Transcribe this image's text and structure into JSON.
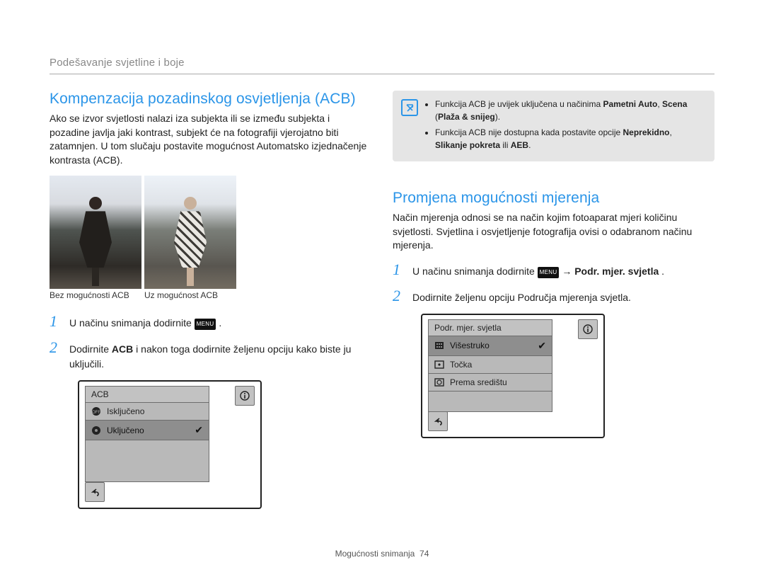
{
  "breadcrumb": "Podešavanje svjetline i boje",
  "left": {
    "heading": "Kompenzacija pozadinskog osvjetljenja (ACB)",
    "intro": "Ako se izvor svjetlosti nalazi iza subjekta ili se između subjekta i pozadine javlja jaki kontrast, subjekt će na fotografiji vjerojatno biti zatamnjen. U tom slučaju postavite mogućnost Automatsko izjednačenje kontrasta (ACB).",
    "caption_left": "Bez mogućnosti ACB",
    "caption_right": "Uz mogućnost ACB",
    "step1_pre": "U načinu snimanja dodirnite ",
    "step1_menu": "MENU",
    "step1_post": " .",
    "step2_a": "Dodirnite ",
    "step2_b": "ACB",
    "step2_c": " i nakon toga dodirnite željenu opciju kako biste ju uključili.",
    "panel": {
      "title": "ACB",
      "row1": "Isključeno",
      "row2": "Uključeno"
    }
  },
  "right": {
    "note_line1_a": "Funkcija ACB je uvijek uključena u načinima ",
    "note_line1_b": "Pametni Auto",
    "note_line1_c": ", ",
    "note_line1_d": "Scena",
    "note_line1_e": " (",
    "note_line1_f": "Plaža & snijeg",
    "note_line1_g": ").",
    "note_line2_a": "Funkcija ACB nije dostupna kada postavite opcije ",
    "note_line2_b": "Neprekidno",
    "note_line2_c": ", ",
    "note_line2_d": "Slikanje pokreta",
    "note_line2_e": " ili ",
    "note_line2_f": "AEB",
    "note_line2_g": ".",
    "heading": "Promjena mogućnosti mjerenja",
    "intro": "Način mjerenja odnosi se na način kojim fotoaparat mjeri količinu svjetlosti. Svjetlina i osvjetljenje fotografija ovisi o odabranom načinu mjerenja.",
    "step1_pre": "U načinu snimanja dodirnite ",
    "step1_menu": "MENU",
    "step1_mid": " → ",
    "step1_bold": "Podr. mjer. svjetla",
    "step1_post": ".",
    "step2": "Dodirnite željenu opciju Područja mjerenja svjetla.",
    "panel": {
      "title": "Podr. mjer. svjetla",
      "row1": "Višestruko",
      "row2": "Točka",
      "row3": "Prema središtu"
    }
  },
  "footer_label": "Mogućnosti snimanja",
  "footer_page": "74"
}
